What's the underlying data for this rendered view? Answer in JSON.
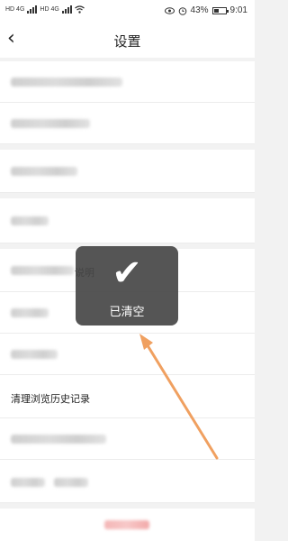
{
  "status_bar": {
    "sim1": "HD 4G",
    "sim2": "HD 4G",
    "battery_percent": "43%",
    "battery_level": 0.43,
    "time": "9:01",
    "icons": [
      "sim-signal-icon",
      "wifi-icon",
      "eye-icon",
      "alarm-icon",
      "battery-icon"
    ]
  },
  "nav": {
    "back_icon": "‹",
    "title": "设置"
  },
  "rows": {
    "clear_history": "清理浏览历史记录",
    "partial_text": "说明"
  },
  "toast": {
    "icon": "✔",
    "message": "已清空"
  },
  "annotation": {
    "arrow_color": "#f0a060"
  }
}
